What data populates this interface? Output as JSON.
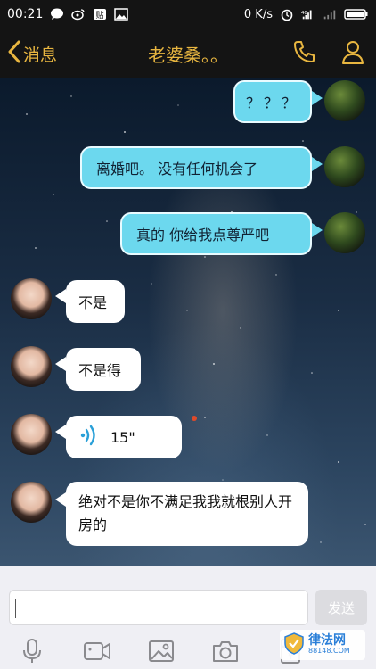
{
  "status_bar": {
    "time": "00:21",
    "net_speed": "0 K/s",
    "left_icons": [
      "chat-icon",
      "weibo-icon",
      "tieba-icon",
      "image-icon"
    ],
    "right_icons": [
      "alarm-icon",
      "signal-4g-icon",
      "signal-icon",
      "battery-icon"
    ]
  },
  "header": {
    "back_label": "消息",
    "title": "老婆桑。。",
    "actions": [
      "phone-icon",
      "profile-icon"
    ],
    "accent_color": "#e8b640"
  },
  "messages": [
    {
      "side": "me",
      "type": "text",
      "text": "？？？"
    },
    {
      "side": "me",
      "type": "text",
      "text": "离婚吧。  没有任何机会了"
    },
    {
      "side": "me",
      "type": "text",
      "text": "真的  你给我点尊严吧"
    },
    {
      "side": "her",
      "type": "text",
      "text": "不是"
    },
    {
      "side": "her",
      "type": "text",
      "text": "不是得"
    },
    {
      "side": "her",
      "type": "voice",
      "text": "15\""
    },
    {
      "side": "her",
      "type": "text",
      "text": "绝对不是你不满足我我就根别人开房的"
    }
  ],
  "input": {
    "placeholder": "",
    "send_label": "发送"
  },
  "toolbar": [
    "microphone-icon",
    "video-icon",
    "image-icon",
    "camera-icon",
    "red-packet-icon"
  ],
  "watermark": {
    "name": "律法网",
    "url": "88148.COM"
  },
  "colors": {
    "my_bubble": "#6cd8ee",
    "her_bubble": "#ffffff",
    "bar_bg": "#141414"
  }
}
